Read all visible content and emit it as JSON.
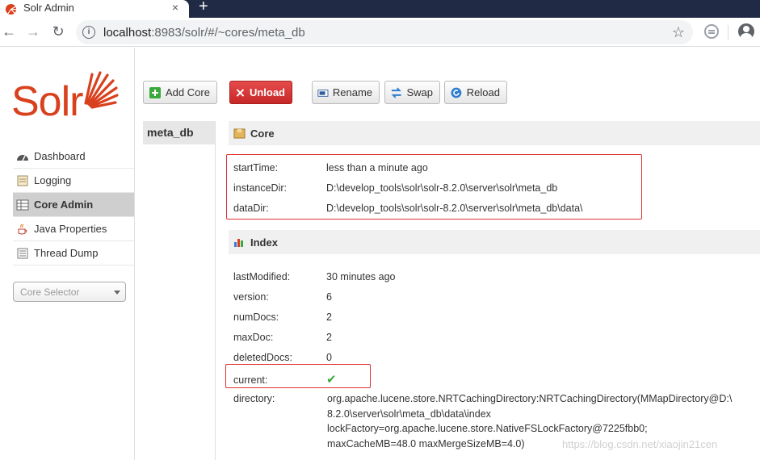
{
  "browser": {
    "tab_title": "Solr Admin",
    "tab_close": "×",
    "new_tab": "+",
    "url_host": "localhost",
    "url_rest": ":8983/solr/#/~cores/meta_db"
  },
  "sidebar": {
    "logo_text": "Solr",
    "items": [
      {
        "label": "Dashboard",
        "icon": "dashboard-icon"
      },
      {
        "label": "Logging",
        "icon": "logging-icon"
      },
      {
        "label": "Core Admin",
        "icon": "core-admin-icon",
        "active": true
      },
      {
        "label": "Java Properties",
        "icon": "java-icon"
      },
      {
        "label": "Thread Dump",
        "icon": "thread-dump-icon"
      }
    ],
    "core_selector_placeholder": "Core Selector"
  },
  "actions": {
    "add_core": "Add Core",
    "unload": "Unload",
    "rename": "Rename",
    "swap": "Swap",
    "reload": "Reload"
  },
  "cores": [
    "meta_db"
  ],
  "core_section": {
    "title": "Core",
    "fields": [
      {
        "key": "startTime:",
        "value": "less than a minute ago"
      },
      {
        "key": "instanceDir:",
        "value": "D:\\develop_tools\\solr\\solr-8.2.0\\server\\solr\\meta_db"
      },
      {
        "key": "dataDir:",
        "value": "D:\\develop_tools\\solr\\solr-8.2.0\\server\\solr\\meta_db\\data\\"
      }
    ]
  },
  "index_section": {
    "title": "Index",
    "fields": [
      {
        "key": "lastModified:",
        "value": "30 minutes ago"
      },
      {
        "key": "version:",
        "value": "6"
      },
      {
        "key": "numDocs:",
        "value": "2"
      },
      {
        "key": "maxDoc:",
        "value": "2"
      },
      {
        "key": "deletedDocs:",
        "value": "0"
      },
      {
        "key": "current:",
        "value": "✔"
      }
    ],
    "directory_key": "directory:",
    "directory_lines": [
      "org.apache.lucene.store.NRTCachingDirectory:NRTCachingDirectory(MMapDirectory@D:\\",
      "8.2.0\\server\\solr\\meta_db\\data\\index",
      "lockFactory=org.apache.lucene.store.NativeFSLockFactory@7225fbb0;",
      "maxCacheMB=48.0 maxMergeSizeMB=4.0)"
    ]
  },
  "watermark": "https://blog.csdn.net/xiaojin21cen",
  "colors": {
    "accent": "#d9411e",
    "highlight": "#e03030",
    "check": "#3aa83a"
  }
}
